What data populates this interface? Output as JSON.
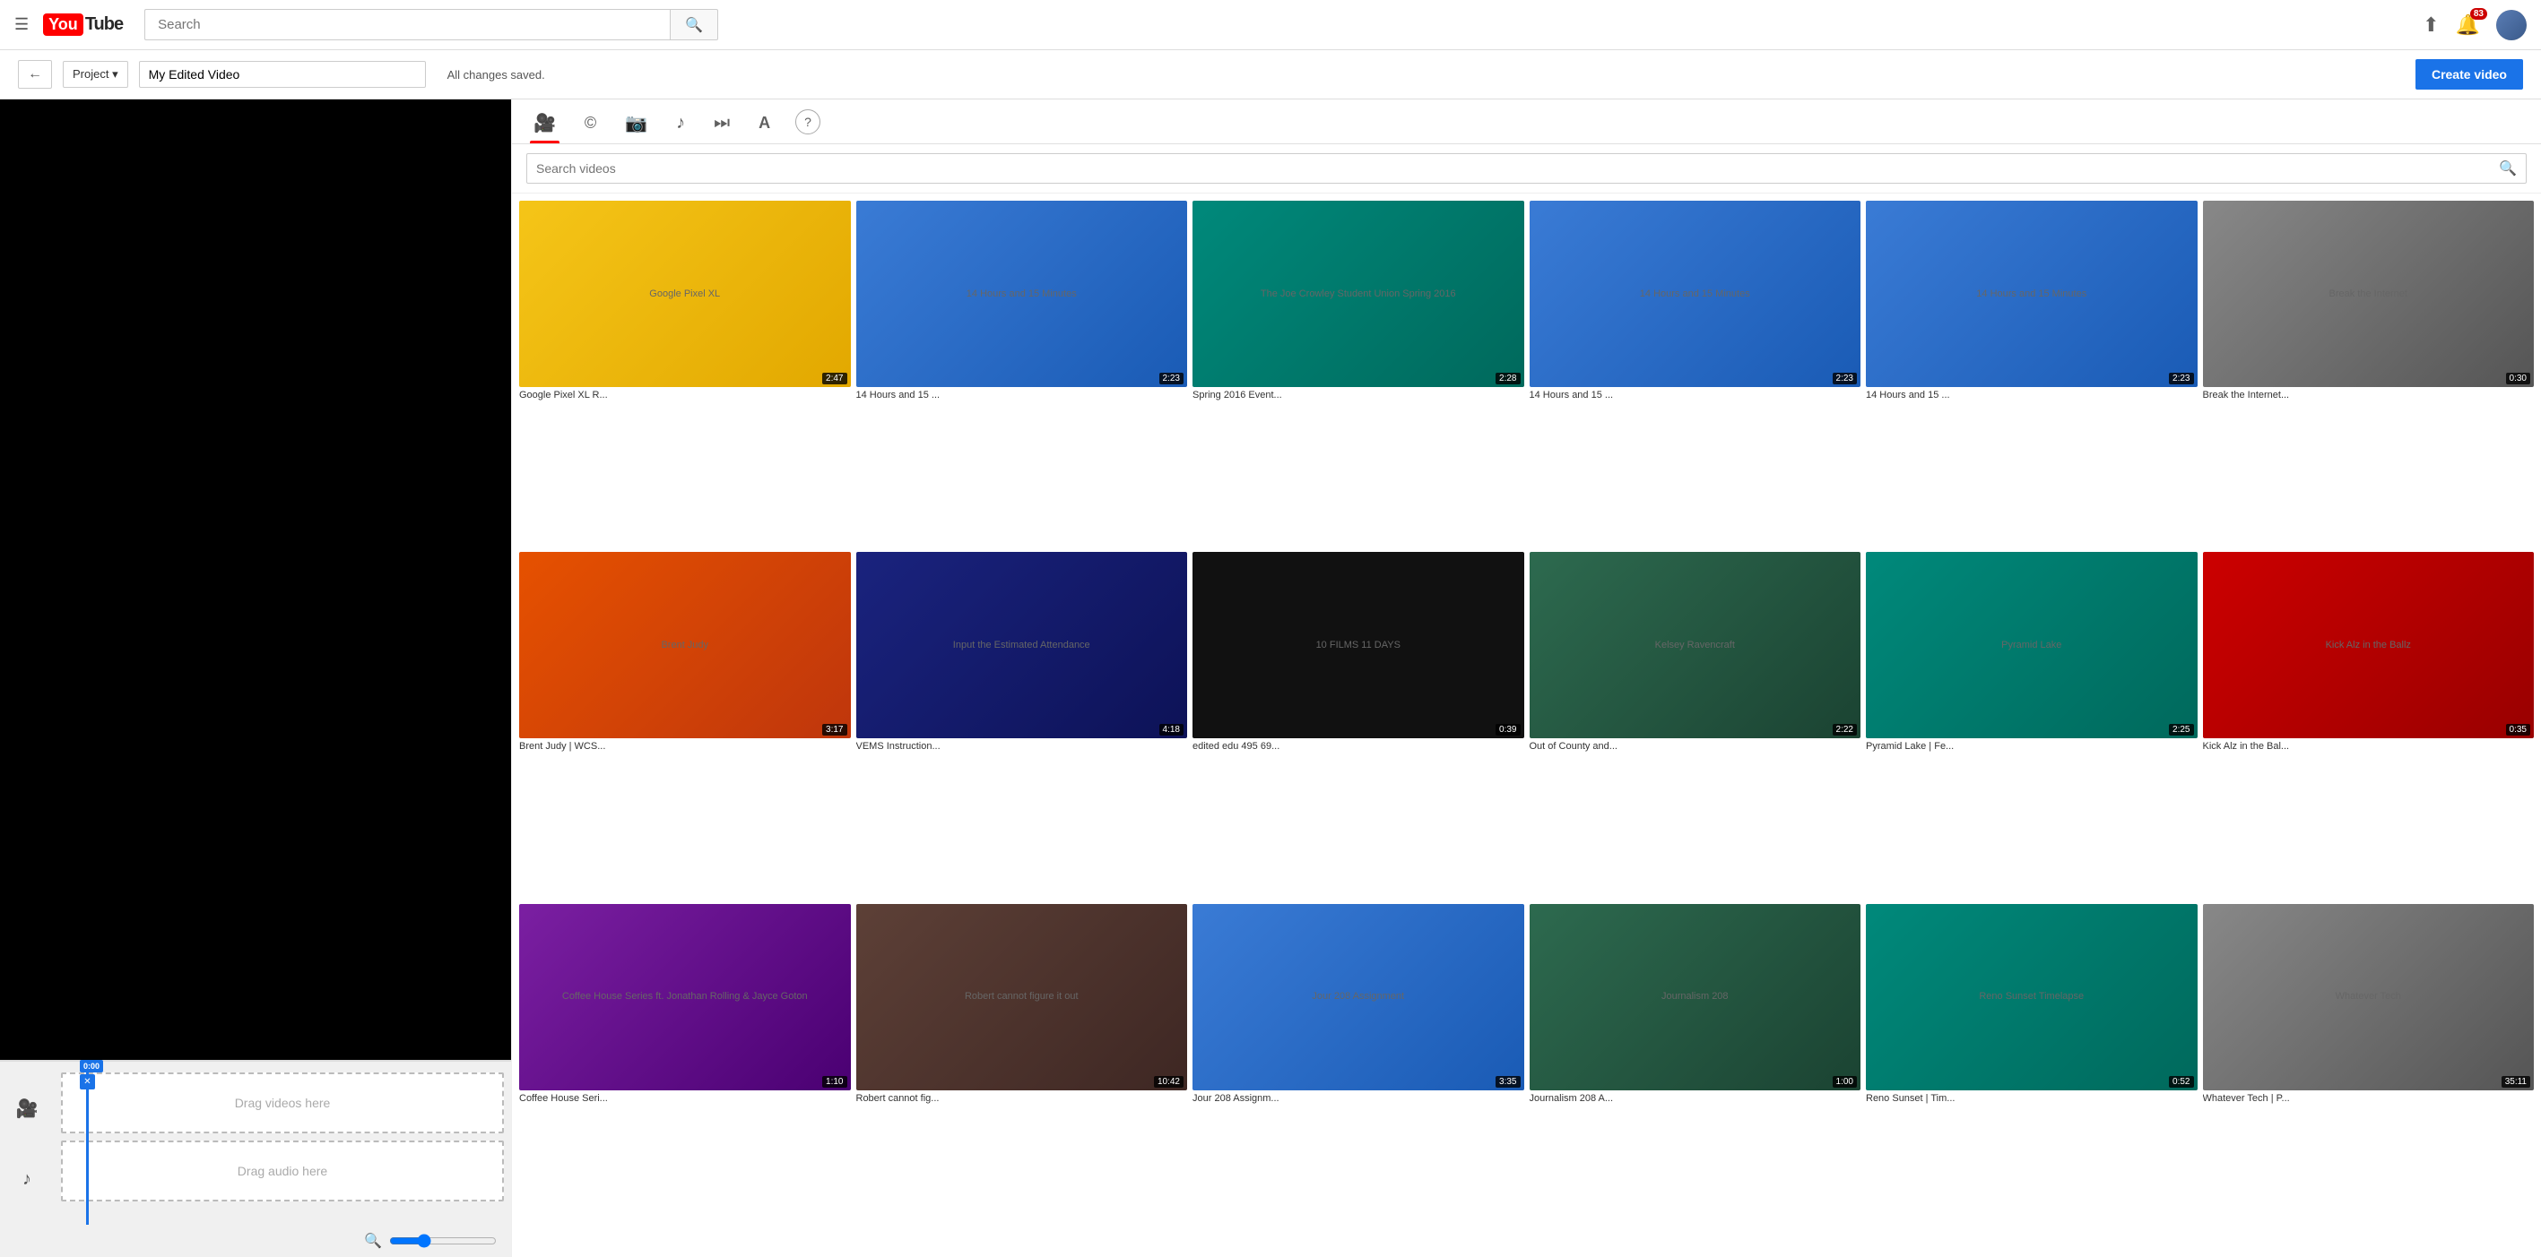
{
  "nav": {
    "search_placeholder": "Search",
    "notification_count": "83",
    "youtube_label": "YouTube"
  },
  "toolbar": {
    "back_label": "←",
    "project_label": "Project ▾",
    "project_name": "My Edited Video",
    "saved_text": "All changes saved.",
    "create_video_label": "Create video"
  },
  "tabs": [
    {
      "id": "video",
      "icon": "🎥",
      "label": "Videos",
      "active": true
    },
    {
      "id": "cc",
      "icon": "©",
      "label": "CC"
    },
    {
      "id": "photo",
      "icon": "📷",
      "label": "Photos"
    },
    {
      "id": "music",
      "icon": "♪",
      "label": "Music"
    },
    {
      "id": "transition",
      "icon": "⏭",
      "label": "Transitions"
    },
    {
      "id": "text",
      "icon": "A",
      "label": "Text"
    },
    {
      "id": "help",
      "icon": "?",
      "label": "Help"
    }
  ],
  "search_videos": {
    "placeholder": "Search videos"
  },
  "videos": [
    {
      "title": "Google Pixel XL R...",
      "duration": "2:47",
      "thumb_class": "thumb-yellow",
      "thumb_text": "Google Pixel XL"
    },
    {
      "title": "14 Hours and 15 ...",
      "duration": "2:23",
      "thumb_class": "thumb-blue",
      "thumb_text": "14 Hours and 15 Minutes"
    },
    {
      "title": "Spring 2016 Event...",
      "duration": "2:28",
      "thumb_class": "thumb-teal",
      "thumb_text": "The Joe Crowley Student Union Spring 2016"
    },
    {
      "title": "14 Hours and 15 ...",
      "duration": "2:23",
      "thumb_class": "thumb-blue",
      "thumb_text": "14 Hours and 15 Minutes"
    },
    {
      "title": "14 Hours and 15 ...",
      "duration": "2:23",
      "thumb_class": "thumb-blue",
      "thumb_text": "14 Hours and 15 Minutes"
    },
    {
      "title": "Break the Internet...",
      "duration": "0:30",
      "thumb_class": "thumb-gray",
      "thumb_text": "Break the Internet"
    },
    {
      "title": "Brent Judy | WCS...",
      "duration": "3:17",
      "thumb_class": "thumb-orange",
      "thumb_text": "Brent Judy"
    },
    {
      "title": "VEMS Instruction...",
      "duration": "4:18",
      "thumb_class": "thumb-navy",
      "thumb_text": "Input the Estimated Attendance"
    },
    {
      "title": "edited edu 495 69...",
      "duration": "0:39",
      "thumb_class": "thumb-black",
      "thumb_text": "10 FILMS 11 DAYS"
    },
    {
      "title": "Out of County and...",
      "duration": "2:22",
      "thumb_class": "thumb-green",
      "thumb_text": "Kelsey Ravencraft"
    },
    {
      "title": "Pyramid Lake | Fe...",
      "duration": "2:25",
      "thumb_class": "thumb-teal",
      "thumb_text": "Pyramid Lake"
    },
    {
      "title": "Kick Alz in the Bal...",
      "duration": "0:35",
      "thumb_class": "thumb-red",
      "thumb_text": "Kick Alz in the Ballz"
    },
    {
      "title": "Coffee House Seri...",
      "duration": "1:10",
      "thumb_class": "thumb-purple",
      "thumb_text": "Coffee House Series ft. Jonathan Rolling & Jayce Goton"
    },
    {
      "title": "Robert cannot fig...",
      "duration": "10:42",
      "thumb_class": "thumb-brown",
      "thumb_text": "Robert cannot figure it out"
    },
    {
      "title": "Jour 208 Assignm...",
      "duration": "3:35",
      "thumb_class": "thumb-blue",
      "thumb_text": "Jour 208 Assignment"
    },
    {
      "title": "Journalism 208 A...",
      "duration": "1:00",
      "thumb_class": "thumb-green",
      "thumb_text": "Journalism 208"
    },
    {
      "title": "Reno Sunset | Tim...",
      "duration": "0:52",
      "thumb_class": "thumb-teal",
      "thumb_text": "Reno Sunset Timelapse"
    },
    {
      "title": "Whatever Tech | P...",
      "duration": "35:11",
      "thumb_class": "thumb-gray",
      "thumb_text": "Whatever Tech"
    }
  ],
  "timeline": {
    "video_track_label": "Drag videos here",
    "audio_track_label": "Drag audio here",
    "time_code": "0:00"
  }
}
